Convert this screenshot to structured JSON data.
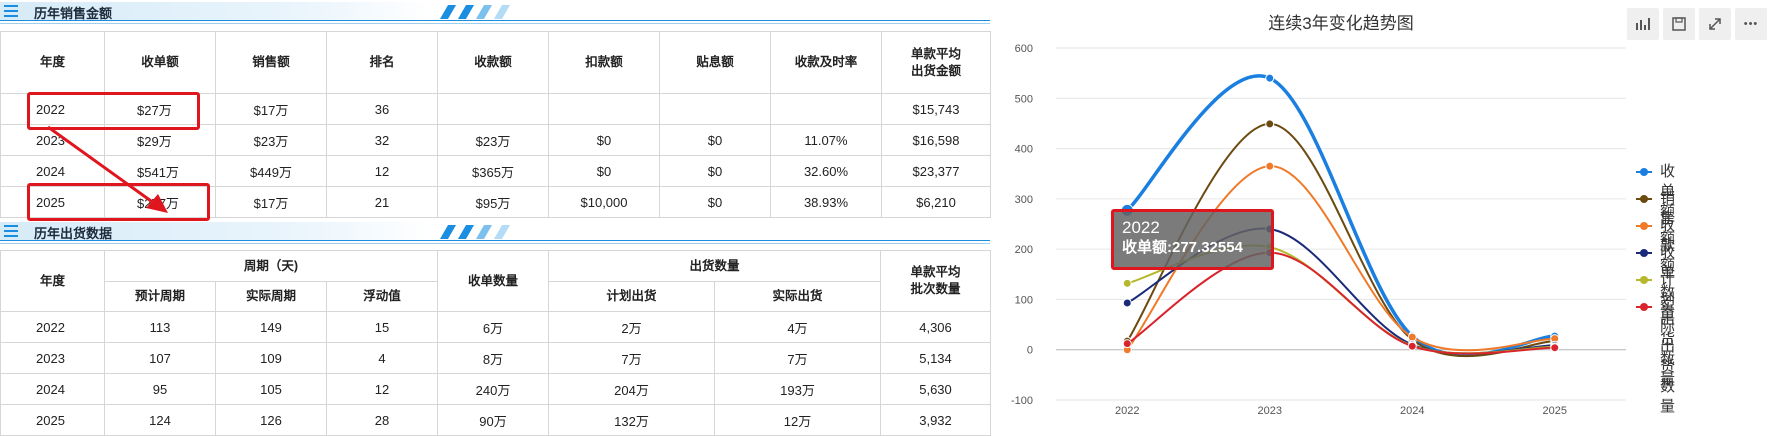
{
  "sales_section": {
    "title": "历年销售金额"
  },
  "sales_table": {
    "headers": [
      "年度",
      "收单额",
      "销售额",
      "排名",
      "收款额",
      "扣款额",
      "贴息额",
      "收款及时率",
      "单款平均\n出货金额"
    ],
    "rows": [
      [
        "2022",
        "$27万",
        "$17万",
        "36",
        "",
        "",
        "",
        "",
        "$15,743"
      ],
      [
        "2023",
        "$29万",
        "$23万",
        "32",
        "$23万",
        "$0",
        "$0",
        "11.07%",
        "$16,598"
      ],
      [
        "2024",
        "$541万",
        "$449万",
        "12",
        "$365万",
        "$0",
        "$0",
        "32.60%",
        "$23,377"
      ],
      [
        "2025",
        "$277万",
        "$17万",
        "21",
        "$95万",
        "$10,000",
        "$0",
        "38.93%",
        "$6,210"
      ]
    ]
  },
  "shipping_section": {
    "title": "历年出货数据"
  },
  "shipping_table": {
    "header_year": "年度",
    "header_period": "周期（天)",
    "header_order_count": "收单数量",
    "header_ship_qty": "出货数量",
    "header_avg": "单款平均\n批次数量",
    "sub_headers": [
      "预计周期",
      "实际周期",
      "浮动值",
      "计划出货",
      "实际出货"
    ],
    "rows": [
      [
        "2022",
        "113",
        "149",
        "15",
        "6万",
        "2万",
        "4万",
        "4,306"
      ],
      [
        "2023",
        "107",
        "109",
        "4",
        "8万",
        "7万",
        "7万",
        "5,134"
      ],
      [
        "2024",
        "95",
        "105",
        "12",
        "240万",
        "204万",
        "193万",
        "5,630"
      ],
      [
        "2025",
        "124",
        "126",
        "28",
        "90万",
        "132万",
        "12万",
        "3,932"
      ]
    ]
  },
  "toolbar": {
    "icons": [
      "bar-chart-icon",
      "save-icon",
      "fullscreen-icon",
      "more-icon"
    ],
    "more_label": "•••"
  },
  "tooltip": {
    "year": "2022",
    "text": "收单额:277.32554"
  },
  "chart_data": {
    "type": "line",
    "title": "连续3年变化趋势图",
    "categories": [
      "2022",
      "2023",
      "2024",
      "2025"
    ],
    "ylim": [
      -100,
      600
    ],
    "yticks": [
      "600",
      "500",
      "400",
      "300",
      "200",
      "100",
      "0",
      "-100"
    ],
    "smooth": true,
    "grid": true,
    "legend_position": "right",
    "series": [
      {
        "name": "收单额",
        "color": "#1a7fe0",
        "values": [
          277,
          540,
          27,
          27
        ]
      },
      {
        "name": "销售额",
        "color": "#6b4a10",
        "values": [
          17,
          449,
          20,
          17
        ]
      },
      {
        "name": "收款额",
        "color": "#f07a2a",
        "values": [
          0,
          365,
          25,
          22
        ]
      },
      {
        "name": "收单数量",
        "color": "#1a2a7a",
        "values": [
          93,
          240,
          10,
          9
        ]
      },
      {
        "name": "计划出货数量",
        "color": "#b5b82a",
        "values": [
          132,
          204,
          8,
          6
        ]
      },
      {
        "name": "实际出货数量",
        "color": "#d8242c",
        "values": [
          12,
          193,
          7,
          4
        ]
      }
    ]
  }
}
